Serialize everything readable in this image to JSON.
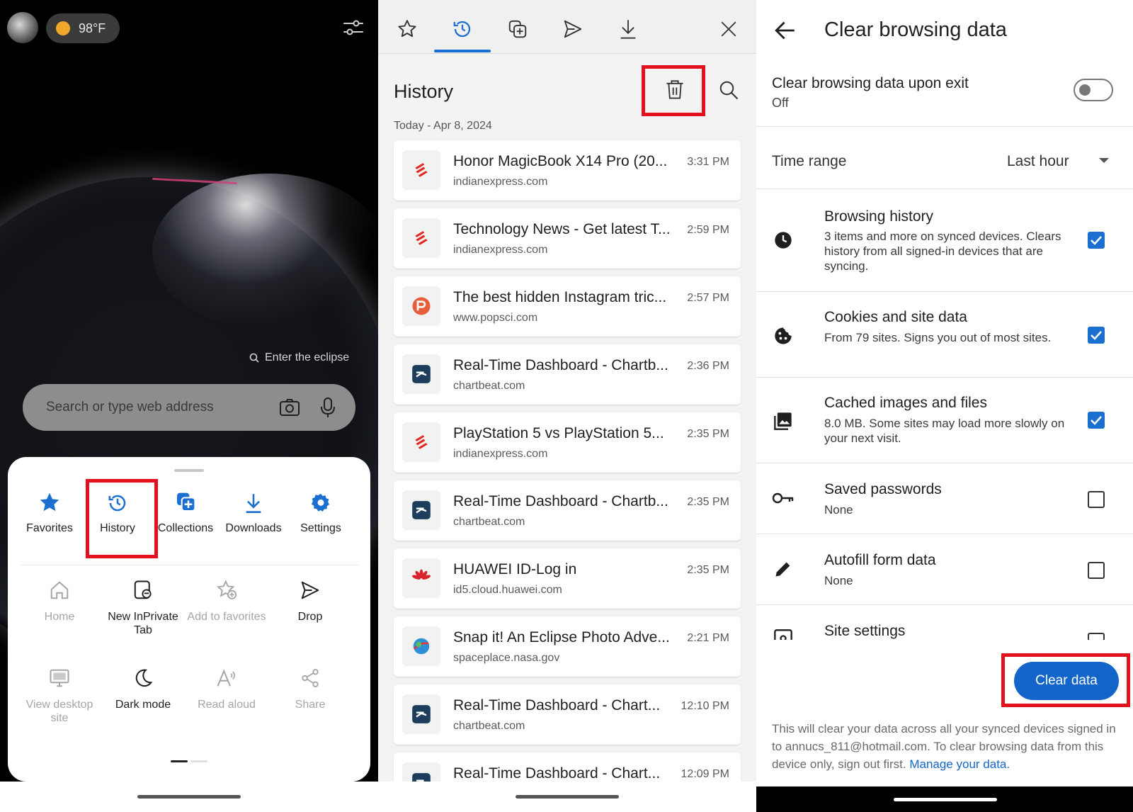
{
  "left": {
    "weather": "98°F",
    "eclipse_link": "Enter the eclipse",
    "search_placeholder": "Search or type web address",
    "top_menu": [
      {
        "label": "Favorites",
        "icon": "star-icon"
      },
      {
        "label": "History",
        "icon": "history-icon"
      },
      {
        "label": "Collections",
        "icon": "collections-icon"
      },
      {
        "label": "Downloads",
        "icon": "download-icon"
      },
      {
        "label": "Settings",
        "icon": "gear-icon"
      }
    ],
    "grid_row1": [
      {
        "label": "Home",
        "enabled": false
      },
      {
        "label": "New InPrivate Tab",
        "enabled": true
      },
      {
        "label": "Add to favorites",
        "enabled": false
      },
      {
        "label": "Drop",
        "enabled": true
      }
    ],
    "grid_row2": [
      {
        "label": "View desktop site",
        "enabled": false
      },
      {
        "label": "Dark mode",
        "enabled": true
      },
      {
        "label": "Read aloud",
        "enabled": false
      },
      {
        "label": "Share",
        "enabled": false
      }
    ],
    "highlight_color": "#e3101e"
  },
  "middle": {
    "tabs": [
      "favorites-tab",
      "history-tab",
      "collections-tab",
      "share-tab",
      "downloads-tab"
    ],
    "active_tab": "history-tab",
    "title": "History",
    "date_header": "Today - Apr 8, 2024",
    "items": [
      {
        "title": "Honor MagicBook X14 Pro (20...",
        "domain": "indianexpress.com",
        "time": "3:31 PM",
        "favicon": "indianexpress"
      },
      {
        "title": "Technology News - Get latest T...",
        "domain": "indianexpress.com",
        "time": "2:59 PM",
        "favicon": "indianexpress"
      },
      {
        "title": "The best hidden Instagram tric...",
        "domain": "www.popsci.com",
        "time": "2:57 PM",
        "favicon": "popsci"
      },
      {
        "title": "Real-Time Dashboard - Chartb...",
        "domain": "chartbeat.com",
        "time": "2:36 PM",
        "favicon": "chartbeat"
      },
      {
        "title": "PlayStation 5 vs PlayStation 5...",
        "domain": "indianexpress.com",
        "time": "2:35 PM",
        "favicon": "indianexpress"
      },
      {
        "title": "Real-Time Dashboard - Chartb...",
        "domain": "chartbeat.com",
        "time": "2:35 PM",
        "favicon": "chartbeat"
      },
      {
        "title": "HUAWEI ID-Log in",
        "domain": "id5.cloud.huawei.com",
        "time": "2:35 PM",
        "favicon": "huawei"
      },
      {
        "title": "Snap it! An Eclipse Photo Adve...",
        "domain": "spaceplace.nasa.gov",
        "time": "2:21 PM",
        "favicon": "nasa"
      },
      {
        "title": "Real-Time Dashboard - Chart...",
        "domain": "chartbeat.com",
        "time": "12:10 PM",
        "favicon": "chartbeat"
      },
      {
        "title": "Real-Time Dashboard - Chart...",
        "domain": "",
        "time": "12:09 PM",
        "favicon": "chartbeat"
      }
    ]
  },
  "right": {
    "title": "Clear browsing data",
    "exit_title": "Clear browsing data upon exit",
    "exit_state": "Off",
    "time_range_label": "Time range",
    "time_range_value": "Last hour",
    "options": [
      {
        "name": "Browsing history",
        "desc": "3 items and more on synced devices. Clears history from all signed-in devices that are syncing.",
        "checked": true,
        "icon": "clock-icon"
      },
      {
        "name": "Cookies and site data",
        "desc": "From 79 sites. Signs you out of most sites.",
        "checked": true,
        "icon": "cookie-icon"
      },
      {
        "name": "Cached images and files",
        "desc": "8.0 MB. Some sites may load more slowly on your next visit.",
        "checked": true,
        "icon": "image-icon"
      },
      {
        "name": "Saved passwords",
        "desc": "None",
        "checked": false,
        "icon": "key-icon"
      },
      {
        "name": "Autofill form data",
        "desc": "None",
        "checked": false,
        "icon": "pencil-icon"
      },
      {
        "name": "Site settings",
        "desc": "",
        "checked": false,
        "icon": "site-settings-icon"
      }
    ],
    "clear_button": "Clear data",
    "footer_text": "This will clear your data across all your synced devices signed in to annucs_811@hotmail.com. To clear browsing data from this device only, sign out first.",
    "footer_link": "Manage your data.",
    "accent_color": "#1465c9"
  }
}
